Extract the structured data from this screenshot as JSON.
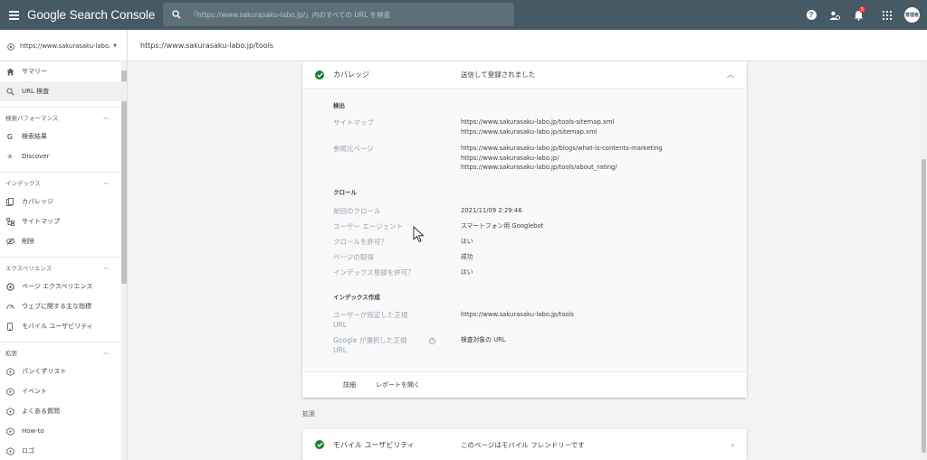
{
  "app": {
    "title": "Google Search Console",
    "search_placeholder": "「https://www.sakurasaku-labo.jp/」内のすべての URL を検査",
    "notification_count": "5",
    "avatar_text": "管理者"
  },
  "property": {
    "name": "https://www.sakurasaku-labo...",
    "inspected_url": "https://www.sakurasaku-labo.jp/tools"
  },
  "sidebar": {
    "top_items": [
      {
        "label": "サマリー",
        "icon": "home-icon"
      },
      {
        "label": "URL 検査",
        "icon": "search-icon"
      }
    ],
    "sections": [
      {
        "title": "検索パフォーマンス",
        "items": [
          {
            "label": "検索結果",
            "icon": "google-g-icon"
          },
          {
            "label": "Discover",
            "icon": "discover-icon"
          }
        ]
      },
      {
        "title": "インデックス",
        "items": [
          {
            "label": "カバレッジ",
            "icon": "coverage-icon"
          },
          {
            "label": "サイトマップ",
            "icon": "sitemap-icon"
          },
          {
            "label": "削除",
            "icon": "removal-icon"
          }
        ]
      },
      {
        "title": "エクスペリエンス",
        "items": [
          {
            "label": "ページ エクスペリエンス",
            "icon": "page-experience-icon"
          },
          {
            "label": "ウェブに関する主な指標",
            "icon": "web-vitals-icon"
          },
          {
            "label": "モバイル ユーザビリティ",
            "icon": "mobile-icon"
          }
        ]
      },
      {
        "title": "拡張",
        "items": [
          {
            "label": "パンくずリスト",
            "icon": "enhancement-icon"
          },
          {
            "label": "イベント",
            "icon": "enhancement-icon"
          },
          {
            "label": "よくある質問",
            "icon": "enhancement-icon"
          },
          {
            "label": "How-to",
            "icon": "enhancement-icon"
          },
          {
            "label": "ロゴ",
            "icon": "enhancement-icon"
          }
        ]
      }
    ]
  },
  "coverage": {
    "title": "カバレッジ",
    "status": "送信して登録されました",
    "discovery_heading": "検出",
    "sitemap_label": "サイトマップ",
    "sitemap_values": [
      "https://www.sakurasaku-labo.jp/tools-sitemap.xml",
      "https://www.sakurasaku-labo.jp/sitemap.xml"
    ],
    "referring_label": "参照元ページ",
    "referring_values": [
      "https://www.sakurasaku-labo.jp/blogs/what-is-contents-marketing",
      "https://www.sakurasaku-labo.jp/",
      "https://www.sakurasaku-labo.jp/tools/about_rating/"
    ],
    "crawl_heading": "クロール",
    "last_crawl_label": "前回のクロール",
    "last_crawl_value": "2021/11/09 2:29:46",
    "user_agent_label": "ユーザー エージェント",
    "user_agent_value": "スマートフォン用 Googlebot",
    "crawl_allowed_label": "クロールを許可？",
    "crawl_allowed_value": "はい",
    "page_fetch_label": "ページの取得",
    "page_fetch_value": "成功",
    "indexing_allowed_label": "インデックス登録を許可？",
    "indexing_allowed_value": "はい",
    "indexing_heading": "インデックス作成",
    "user_canonical_label": "ユーザーが指定した正規 URL",
    "user_canonical_value": "https://www.sakurasaku-labo.jp/tools",
    "google_canonical_label": "Google が選択した正規 URL",
    "google_canonical_value": "検査対象の URL",
    "details_button": "詳細",
    "open_report_button": "レポートを開く"
  },
  "enhancements": {
    "label": "拡張",
    "mobile_title": "モバイル ユーザビリティ",
    "mobile_status": "このページはモバイル フレンドリーです"
  },
  "colors": {
    "topbar": "#455a64",
    "success": "#188038"
  }
}
